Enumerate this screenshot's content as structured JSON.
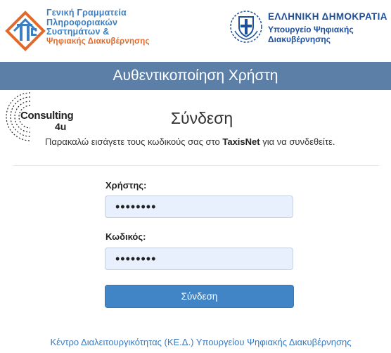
{
  "header": {
    "gsis_logo_lines": [
      "Γενική Γραμματεία",
      "Πληροφοριακών",
      "Συστημάτων &",
      "Ψηφιακής Διακυβέρνησης"
    ],
    "gov_title": "ΕΛΛΗΝΙΚΗ ΔΗΜΟΚΡΑΤΙΑ",
    "ministry_line1": "Υπουργείο Ψηφιακής",
    "ministry_line2": "Διακυβέρνησης"
  },
  "banner": {
    "title": "Αυθεντικοποίηση Χρήστη"
  },
  "consulting_logo": {
    "word": "Consulting",
    "suffix": "4u"
  },
  "login": {
    "title": "Σύνδεση",
    "instructions_before": "Παρακαλώ εισάγετε τους κωδικούς σας στο ",
    "instructions_bold": "TaxisNet",
    "instructions_after": " για να συνδεθείτε.",
    "username_label": "Χρήστης:",
    "username_value": "••••••••",
    "password_label": "Κωδικός:",
    "password_value": "••••••••",
    "submit_label": "Σύνδεση"
  },
  "footer": {
    "link_text": "Κέντρο Διαλειτουργικότητας (ΚΕ.Δ.) Υπουργείου Ψηφιακής Διακυβέρνησης"
  },
  "colors": {
    "banner": "#5c7fa8",
    "button": "#4285c6",
    "link": "#3a7abf",
    "orange": "#e06a2c",
    "blue": "#3b7fc0"
  },
  "icons": [
    "gsis-logo-icon",
    "greek-emblem-icon",
    "consulting4u-logo-icon"
  ]
}
